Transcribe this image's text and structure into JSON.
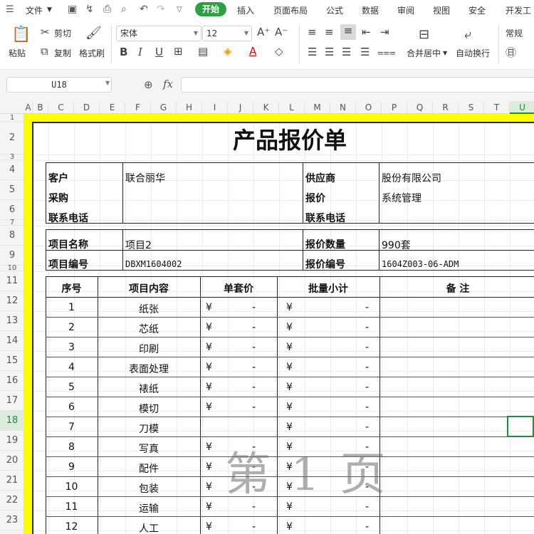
{
  "menu": {
    "file": "文件",
    "tabs": [
      "开始",
      "插入",
      "页面布局",
      "公式",
      "数据",
      "审阅",
      "视图",
      "安全",
      "开发工"
    ]
  },
  "ribbon": {
    "paste": "粘贴",
    "cut": "剪切",
    "copy": "复制",
    "format_painter": "格式刷",
    "font_name": "宋体",
    "font_size": "12",
    "merge_center": "合并居中",
    "wrap_text": "自动换行",
    "number_format": "常规"
  },
  "formula_bar": {
    "name_box": "U18",
    "fx": "fx",
    "formula": ""
  },
  "columns": [
    "A",
    "B",
    "C",
    "D",
    "E",
    "F",
    "G",
    "H",
    "I",
    "J",
    "K",
    "L",
    "M",
    "N",
    "O",
    "P",
    "Q",
    "R",
    "S",
    "T",
    "U"
  ],
  "rows": [
    "1",
    "2",
    "3",
    "4",
    "5",
    "6",
    "7",
    "8",
    "9",
    "10",
    "11",
    "12",
    "13",
    "14",
    "15",
    "16",
    "17",
    "18",
    "19",
    "20",
    "21",
    "22",
    "23"
  ],
  "title": "产品报价单",
  "info_block1": {
    "customer_label": "客户",
    "customer_value": "联合丽华",
    "supplier_label": "供应商",
    "supplier_value": "股份有限公司",
    "purchase_label": "采购",
    "purchase_value": "",
    "quote_label": "报价",
    "quote_value": "系统管理",
    "phone_label": "联系电话",
    "phone_value": "",
    "phone2_label": "联系电话",
    "phone2_value": ""
  },
  "info_block2": {
    "project_name_label": "项目名称",
    "project_name_value": "项目2",
    "quote_qty_label": "报价数量",
    "quote_qty_value": "990套",
    "project_no_label": "项目编号",
    "project_no_value": "DBXM1604002",
    "quote_no_label": "报价编号",
    "quote_no_value": "1604Z003-06-ADM"
  },
  "table": {
    "headers": [
      "序号",
      "项目内容",
      "单套价",
      "批量小计",
      "备 注"
    ],
    "rows": [
      {
        "no": "1",
        "item": "纸张",
        "unit": "¥",
        "unit_val": "-",
        "batch": "¥",
        "batch_val": "-"
      },
      {
        "no": "2",
        "item": "芯纸",
        "unit": "¥",
        "unit_val": "-",
        "batch": "¥",
        "batch_val": "-"
      },
      {
        "no": "3",
        "item": "印刷",
        "unit": "¥",
        "unit_val": "-",
        "batch": "¥",
        "batch_val": "-"
      },
      {
        "no": "4",
        "item": "表面处理",
        "unit": "¥",
        "unit_val": "-",
        "batch": "¥",
        "batch_val": "-"
      },
      {
        "no": "5",
        "item": "裱纸",
        "unit": "¥",
        "unit_val": "-",
        "batch": "¥",
        "batch_val": "-"
      },
      {
        "no": "6",
        "item": "模切",
        "unit": "¥",
        "unit_val": "-",
        "batch": "¥",
        "batch_val": "-"
      },
      {
        "no": "7",
        "item": "刀模",
        "unit": "",
        "unit_val": "",
        "batch": "¥",
        "batch_val": "-"
      },
      {
        "no": "8",
        "item": "写真",
        "unit": "¥",
        "unit_val": "-",
        "batch": "¥",
        "batch_val": "-"
      },
      {
        "no": "9",
        "item": "配件",
        "unit": "¥",
        "unit_val": "-",
        "batch": "¥",
        "batch_val": "-"
      },
      {
        "no": "10",
        "item": "包装",
        "unit": "¥",
        "unit_val": "-",
        "batch": "¥",
        "batch_val": "-"
      },
      {
        "no": "11",
        "item": "运输",
        "unit": "¥",
        "unit_val": "-",
        "batch": "¥",
        "batch_val": "-"
      },
      {
        "no": "12",
        "item": "人工",
        "unit": "¥",
        "unit_val": "-",
        "batch": "¥",
        "batch_val": "-"
      }
    ]
  },
  "watermark": "第 1 页"
}
